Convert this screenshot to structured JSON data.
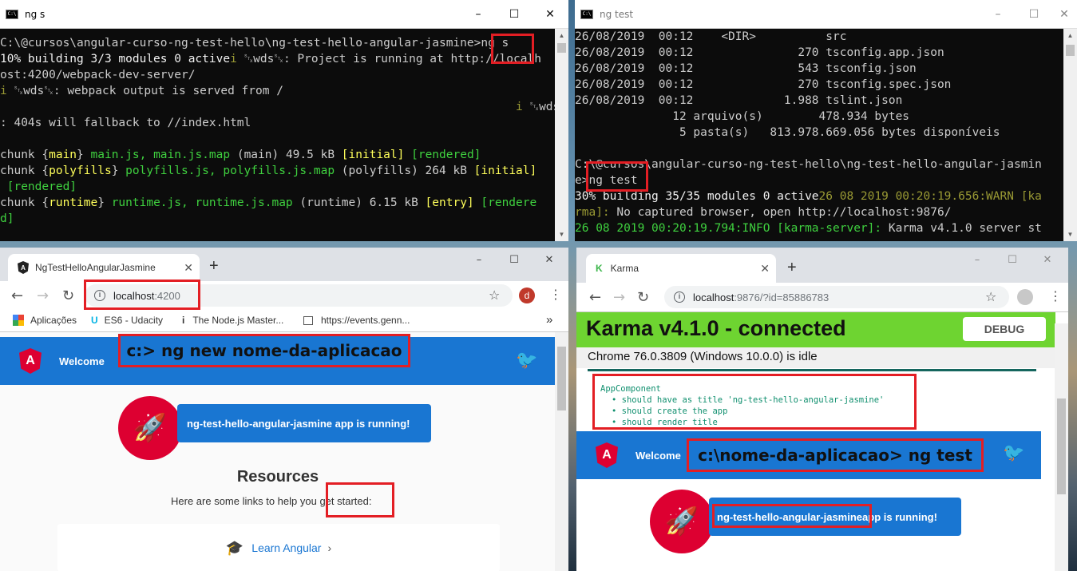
{
  "cmd1": {
    "title": "ng s",
    "lines": [
      {
        "segs": [
          {
            "t": "C:\\@cursos\\angular-curso-ng-test-hello\\ng-test-hello-angular-jasmine>ng s"
          }
        ]
      },
      {
        "segs": [
          {
            "t": "10% building 3/3 modules 0 active",
            "c": "wh"
          },
          {
            "t": "i ",
            "c": "dg"
          },
          {
            "t": "␂wds␂: Project is running at http://localh"
          }
        ]
      },
      {
        "segs": [
          {
            "t": "ost:4200/webpack-dev-server/"
          }
        ]
      },
      {
        "segs": [
          {
            "t": "i ",
            "c": "dg"
          },
          {
            "t": "␂wds␂: webpack output is served from /"
          }
        ]
      },
      {
        "segs": [
          {
            "t": "                                                                          i ",
            "c": "dg"
          },
          {
            "t": "␂wds␂"
          }
        ]
      },
      {
        "segs": [
          {
            "t": ": 404s will fallback to //index.html"
          }
        ]
      },
      {
        "segs": [
          {
            "t": ""
          }
        ]
      },
      {
        "segs": [
          {
            "t": "chunk {"
          },
          {
            "t": "main",
            "c": "y"
          },
          {
            "t": "} "
          },
          {
            "t": "main.js, main.js.map",
            "c": "g"
          },
          {
            "t": " (main) 49.5 kB "
          },
          {
            "t": "[initial]",
            "c": "y"
          },
          {
            "t": " "
          },
          {
            "t": "[rendered]",
            "c": "g"
          }
        ]
      },
      {
        "segs": [
          {
            "t": "chunk {"
          },
          {
            "t": "polyfills",
            "c": "y"
          },
          {
            "t": "} "
          },
          {
            "t": "polyfills.js, polyfills.js.map",
            "c": "g"
          },
          {
            "t": " (polyfills) 264 kB "
          },
          {
            "t": "[initial]",
            "c": "y"
          }
        ]
      },
      {
        "segs": [
          {
            "t": " "
          },
          {
            "t": "[rendered]",
            "c": "g"
          }
        ]
      },
      {
        "segs": [
          {
            "t": "chunk {"
          },
          {
            "t": "runtime",
            "c": "y"
          },
          {
            "t": "} "
          },
          {
            "t": "runtime.js, runtime.js.map",
            "c": "g"
          },
          {
            "t": " (runtime) 6.15 kB "
          },
          {
            "t": "[entry]",
            "c": "y"
          },
          {
            "t": " "
          },
          {
            "t": "[rendere",
            "c": "g"
          }
        ]
      },
      {
        "segs": [
          {
            "t": "d]",
            "c": "g"
          }
        ]
      }
    ]
  },
  "cmd2": {
    "title": "ng test",
    "lines": [
      {
        "segs": [
          {
            "t": "26/08/2019  00:12    <DIR>          src"
          }
        ]
      },
      {
        "segs": [
          {
            "t": "26/08/2019  00:12               270 tsconfig.app.json"
          }
        ]
      },
      {
        "segs": [
          {
            "t": "26/08/2019  00:12               543 tsconfig.json"
          }
        ]
      },
      {
        "segs": [
          {
            "t": "26/08/2019  00:12               270 tsconfig.spec.json"
          }
        ]
      },
      {
        "segs": [
          {
            "t": "26/08/2019  00:12             1.988 tslint.json"
          }
        ]
      },
      {
        "segs": [
          {
            "t": "              12 arquivo(s)        478.934 bytes"
          }
        ]
      },
      {
        "segs": [
          {
            "t": "               5 pasta(s)   813.978.669.056 bytes disponíveis"
          }
        ]
      },
      {
        "segs": [
          {
            "t": ""
          }
        ]
      },
      {
        "segs": [
          {
            "t": "C:\\@cursos\\angular-curso-ng-test-hello\\ng-test-hello-angular-jasmin"
          }
        ]
      },
      {
        "segs": [
          {
            "t": "e>ng test"
          }
        ]
      },
      {
        "segs": [
          {
            "t": "30% building 35/35 modules 0 active",
            "c": "wh"
          },
          {
            "t": "26 08 2019 00:20:19.656:WARN [ka",
            "c": "dg"
          }
        ]
      },
      {
        "segs": [
          {
            "t": "rma]: ",
            "c": "dg"
          },
          {
            "t": "No captured browser, open http://localhost:9876/"
          }
        ]
      },
      {
        "segs": [
          {
            "t": "26 08 2019 00:20:19.794:INFO [karma-server]: ",
            "c": "g"
          },
          {
            "t": "Karma v4.1.0 server st"
          }
        ]
      }
    ]
  },
  "browser1": {
    "tab_title": "NgTestHelloAngularJasmine",
    "url_host": "localhost",
    "url_port": ":4200",
    "profile_initial": "d",
    "bookmarks": [
      {
        "label": "Aplicações"
      },
      {
        "label": "ES6 - Udacity"
      },
      {
        "label": "The Node.js Master..."
      },
      {
        "label": "https://events.genn..."
      }
    ],
    "welcome": "Welcome",
    "app_running": "ng-test-hello-angular-jasmine app is running!",
    "resources": "Resources",
    "resources_sub_a": "Here are some links to help you ",
    "resources_sub_b": "get started:",
    "learn": "Learn Angular",
    "callout": "c:> ng new nome-da-aplicacao"
  },
  "browser2": {
    "tab_title": "Karma",
    "url_host": "localhost",
    "url_rest": ":9876/?id=85886783",
    "karma_title": "Karma v4.1.0 - connected",
    "debug": "DEBUG",
    "browser_status": "Chrome 76.0.3809 (Windows 10.0.0) is idle",
    "suite": "AppComponent",
    "specs": [
      "should have as title 'ng-test-hello-angular-jasmine'",
      "should create the app",
      "should render title"
    ],
    "welcome": "Welcome",
    "callout": "c:\\nome-da-aplicacao> ng test",
    "app_running_a": "ng-test-hello-angular-jasmine",
    "app_running_b": " app is running!"
  },
  "colors": {
    "angular_blue": "#1976d2",
    "angular_red": "#dd0031",
    "karma_green": "#6ed431",
    "highlight_red": "#e31e24"
  }
}
